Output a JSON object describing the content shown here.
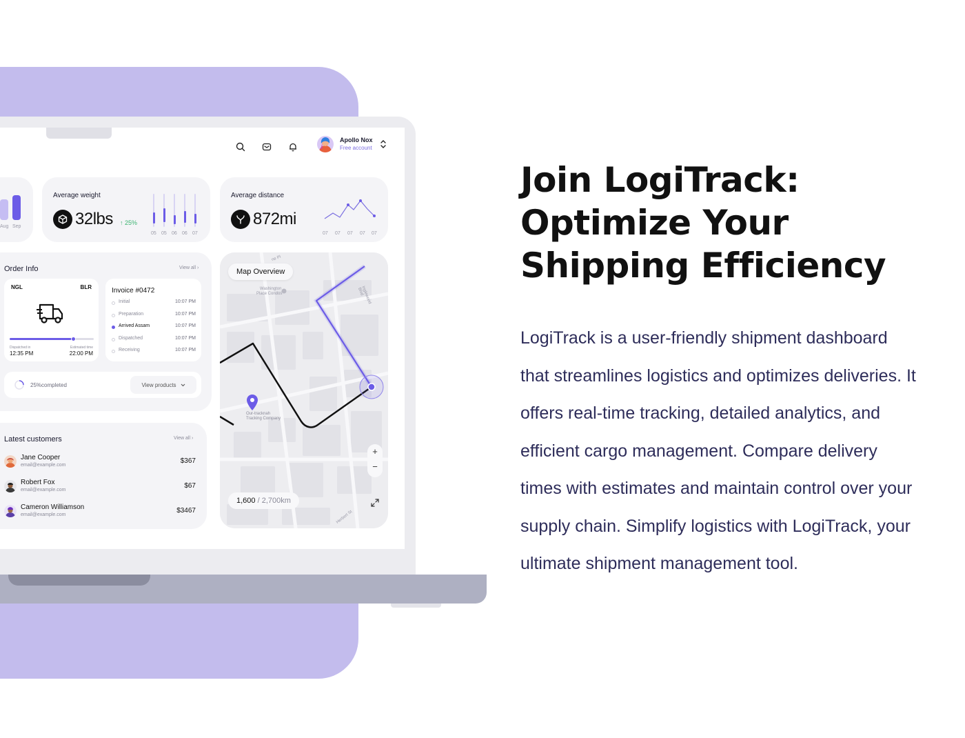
{
  "dashboard": {
    "user": {
      "name": "Apollo Nox",
      "plan": "Free account"
    },
    "partial_chart_labels": [
      "Aug",
      "Sep"
    ],
    "avg_weight": {
      "label": "Average weight",
      "value": "32lbs",
      "change": "↑ 25%",
      "axis": [
        "05",
        "05",
        "06",
        "06",
        "07"
      ],
      "levels": [
        0.55,
        0.7,
        0.45,
        0.6,
        0.5
      ]
    },
    "avg_distance": {
      "label": "Average distance",
      "value": "872mi",
      "axis": [
        "07",
        "07",
        "07",
        "07",
        "07"
      ]
    },
    "order_info": {
      "title": "Order Info",
      "view_all": "View all",
      "from": "NGL",
      "to": "BLR",
      "progress": 0.75,
      "dispatched_label": "Dispatched in",
      "dispatched_time": "12:35 PM",
      "estimated_label": "Estimated time",
      "estimated_time": "22:00 PM",
      "invoice": "Invoice #0472",
      "steps": [
        {
          "name": "Initial",
          "time": "10:07 PM",
          "active": false
        },
        {
          "name": "Preparation",
          "time": "10:07 PM",
          "active": false
        },
        {
          "name": "Arrived Assam",
          "time": "10:07 PM",
          "active": true
        },
        {
          "name": "Dispatched",
          "time": "10:07 PM",
          "active": false
        },
        {
          "name": "Receiving",
          "time": "10:07 PM",
          "active": false
        }
      ],
      "completed": "25%completed",
      "view_products": "View products"
    },
    "customers": {
      "title": "Latest customers",
      "view_all": "View all",
      "items": [
        {
          "name": "Jane Cooper",
          "email": "email@example.com",
          "amount": "$367"
        },
        {
          "name": "Robert Fox",
          "email": "email@example.com",
          "amount": "$67"
        },
        {
          "name": "Cameron Williamson",
          "email": "email@example.com",
          "amount": "$3467"
        }
      ]
    },
    "map": {
      "title": "Map Overview",
      "distance_done": "1,600",
      "distance_total": "/ 2,700km",
      "labels": {
        "place1": "Washington",
        "place1b": "Place Condos",
        "place2": "Our-tracknah",
        "place2b": "Tracking Company",
        "street1": "Inglewood Blvd",
        "street2": "Herbert St",
        "street3": "ne Pl"
      },
      "zoom_in": "+",
      "zoom_out": "−"
    }
  },
  "marketing": {
    "headline": [
      "Join LogiTrack:",
      "Optimize Your",
      "Shipping Efficiency"
    ],
    "body": [
      "LogiTrack is a user-friendly shipment dashboard",
      "that streamlines logistics and optimizes deliveries. It",
      "offers real-time tracking, detailed analytics, and",
      "efficient cargo management. Compare delivery",
      "times with estimates and maintain control over your",
      "supply chain. Simplify logistics with LogiTrack, your",
      "ultimate shipment management tool."
    ]
  },
  "colors": {
    "accent": "#6c5ce7",
    "purple_bg": "#c3bced",
    "text_dark": "#111111",
    "body_text": "#2e2d5a"
  }
}
